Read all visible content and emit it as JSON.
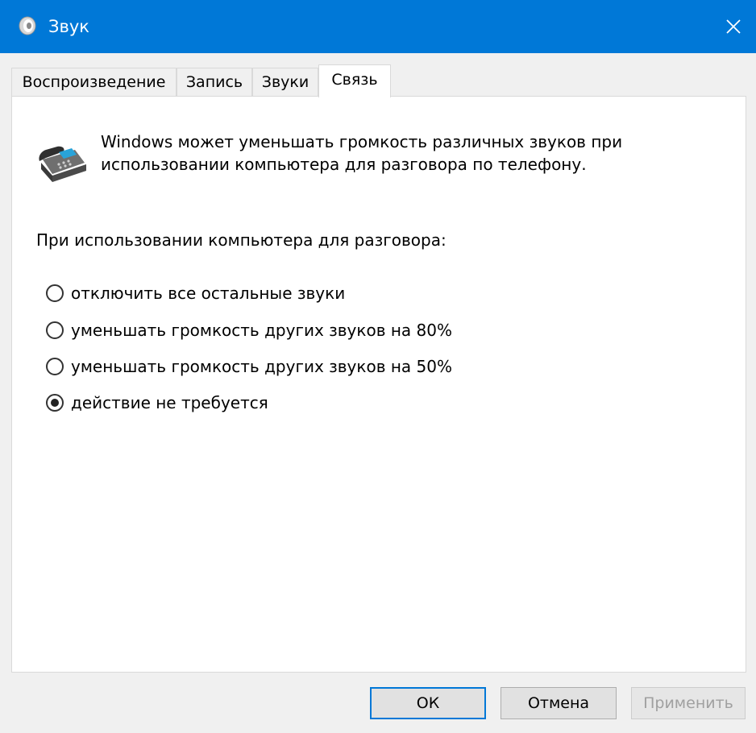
{
  "window": {
    "title": "Звук",
    "app_icon": "speaker-icon",
    "close_icon": "close-icon"
  },
  "tabs": [
    {
      "label": "Воспроизведение",
      "active": false
    },
    {
      "label": "Запись",
      "active": false
    },
    {
      "label": "Звуки",
      "active": false
    },
    {
      "label": "Связь",
      "active": true
    }
  ],
  "communications": {
    "icon": "phone-icon",
    "description_line1": "Windows может уменьшать громкость различных звуков при",
    "description_line2": "использовании компьютера для разговора по телефону.",
    "group_label": "При использовании компьютера для разговора:",
    "options": [
      {
        "label": "отключить все остальные звуки",
        "checked": false
      },
      {
        "label": "уменьшать громкость других звуков на 80%",
        "checked": false
      },
      {
        "label": "уменьшать громкость других звуков на 50%",
        "checked": false
      },
      {
        "label": "действие не требуется",
        "checked": true
      }
    ]
  },
  "buttons": {
    "ok": "ОК",
    "cancel": "Отмена",
    "apply": "Применить"
  },
  "colors": {
    "titlebar": "#0078d7",
    "default_button_border": "#0078d7"
  }
}
